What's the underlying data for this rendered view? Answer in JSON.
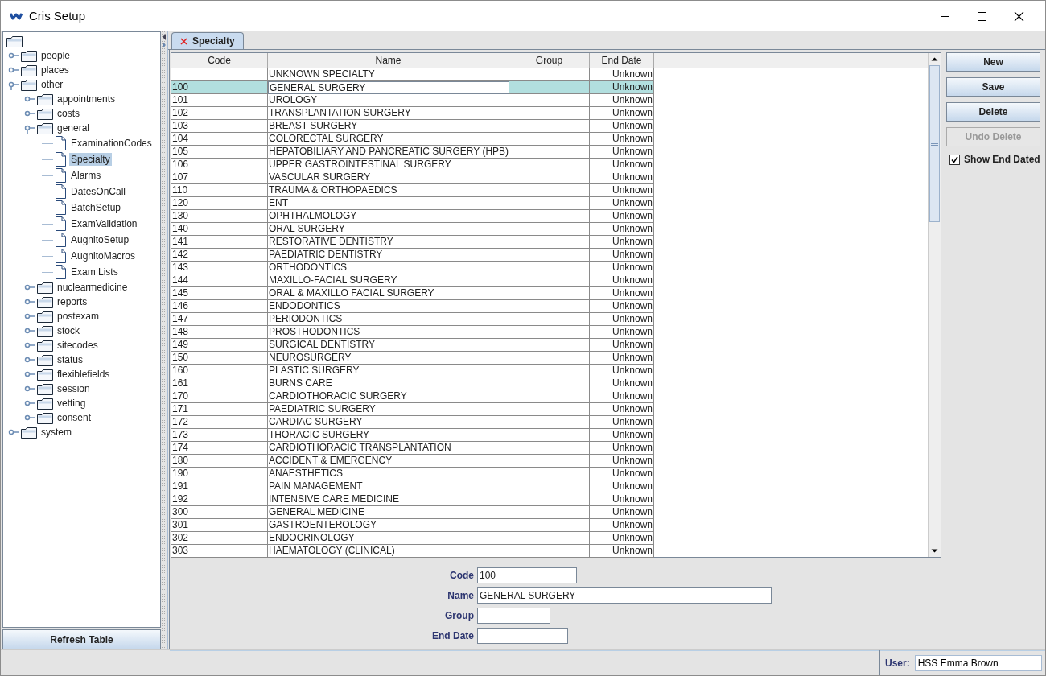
{
  "window": {
    "title": "Cris Setup"
  },
  "tree": {
    "kind": "root",
    "children": [
      {
        "kind": "folder",
        "label": "people",
        "expanded": false,
        "selected": false
      },
      {
        "kind": "folder",
        "label": "places",
        "expanded": false,
        "selected": false
      },
      {
        "kind": "folder",
        "label": "other",
        "expanded": true,
        "selected": false,
        "children": [
          {
            "kind": "folder",
            "label": "appointments",
            "expanded": false,
            "selected": false
          },
          {
            "kind": "folder",
            "label": "costs",
            "expanded": false,
            "selected": false
          },
          {
            "kind": "folder",
            "label": "general",
            "expanded": true,
            "selected": false,
            "children": [
              {
                "kind": "leaf",
                "label": "ExaminationCodes",
                "selected": false
              },
              {
                "kind": "leaf",
                "label": "Specialty",
                "selected": true
              },
              {
                "kind": "leaf",
                "label": "Alarms",
                "selected": false
              },
              {
                "kind": "leaf",
                "label": "DatesOnCall",
                "selected": false
              },
              {
                "kind": "leaf",
                "label": "BatchSetup",
                "selected": false
              },
              {
                "kind": "leaf",
                "label": "ExamValidation",
                "selected": false
              },
              {
                "kind": "leaf",
                "label": "AugnitoSetup",
                "selected": false
              },
              {
                "kind": "leaf",
                "label": "AugnitoMacros",
                "selected": false
              },
              {
                "kind": "leaf",
                "label": "Exam Lists",
                "selected": false
              }
            ]
          },
          {
            "kind": "folder",
            "label": "nuclearmedicine",
            "expanded": false,
            "selected": false
          },
          {
            "kind": "folder",
            "label": "reports",
            "expanded": false,
            "selected": false
          },
          {
            "kind": "folder",
            "label": "postexam",
            "expanded": false,
            "selected": false
          },
          {
            "kind": "folder",
            "label": "stock",
            "expanded": false,
            "selected": false
          },
          {
            "kind": "folder",
            "label": "sitecodes",
            "expanded": false,
            "selected": false
          },
          {
            "kind": "folder",
            "label": "status",
            "expanded": false,
            "selected": false
          },
          {
            "kind": "folder",
            "label": "flexiblefields",
            "expanded": false,
            "selected": false
          },
          {
            "kind": "folder",
            "label": "session",
            "expanded": false,
            "selected": false
          },
          {
            "kind": "folder",
            "label": "vetting",
            "expanded": false,
            "selected": false
          },
          {
            "kind": "folder",
            "label": "consent",
            "expanded": false,
            "selected": false
          }
        ]
      },
      {
        "kind": "folder",
        "label": "system",
        "expanded": false,
        "selected": false
      }
    ]
  },
  "refresh_button": "Refresh Table",
  "tabs": [
    {
      "label": "Specialty",
      "selected": true
    }
  ],
  "table": {
    "columns": [
      "Code",
      "Name",
      "Group",
      "End Date"
    ],
    "rows": [
      {
        "name": "UNKNOWN SPECIALTY",
        "end_date": "Unknown",
        "selected": false
      },
      {
        "code": "100",
        "name": "GENERAL SURGERY",
        "end_date": "Unknown",
        "selected": true
      },
      {
        "code": "101",
        "name": "UROLOGY",
        "end_date": "Unknown",
        "selected": false
      },
      {
        "code": "102",
        "name": "TRANSPLANTATION SURGERY",
        "end_date": "Unknown",
        "selected": false
      },
      {
        "code": "103",
        "name": "BREAST SURGERY",
        "end_date": "Unknown",
        "selected": false
      },
      {
        "code": "104",
        "name": "COLORECTAL SURGERY",
        "end_date": "Unknown",
        "selected": false
      },
      {
        "code": "105",
        "name": "HEPATOBILIARY AND PANCREATIC SURGERY (HPB)",
        "end_date": "Unknown",
        "selected": false
      },
      {
        "code": "106",
        "name": "UPPER GASTROINTESTINAL SURGERY",
        "end_date": "Unknown",
        "selected": false
      },
      {
        "code": "107",
        "name": "VASCULAR SURGERY",
        "end_date": "Unknown",
        "selected": false
      },
      {
        "code": "110",
        "name": "TRAUMA & ORTHOPAEDICS",
        "end_date": "Unknown",
        "selected": false
      },
      {
        "code": "120",
        "name": "ENT",
        "end_date": "Unknown",
        "selected": false
      },
      {
        "code": "130",
        "name": "OPHTHALMOLOGY",
        "end_date": "Unknown",
        "selected": false
      },
      {
        "code": "140",
        "name": "ORAL SURGERY",
        "end_date": "Unknown",
        "selected": false
      },
      {
        "code": "141",
        "name": "RESTORATIVE DENTISTRY",
        "end_date": "Unknown",
        "selected": false
      },
      {
        "code": "142",
        "name": "PAEDIATRIC DENTISTRY",
        "end_date": "Unknown",
        "selected": false
      },
      {
        "code": "143",
        "name": "ORTHODONTICS",
        "end_date": "Unknown",
        "selected": false
      },
      {
        "code": "144",
        "name": "MAXILLO-FACIAL SURGERY",
        "end_date": "Unknown",
        "selected": false
      },
      {
        "code": "145",
        "name": "ORAL & MAXILLO FACIAL SURGERY",
        "end_date": "Unknown",
        "selected": false
      },
      {
        "code": "146",
        "name": "ENDODONTICS",
        "end_date": "Unknown",
        "selected": false
      },
      {
        "code": "147",
        "name": "PERIODONTICS",
        "end_date": "Unknown",
        "selected": false
      },
      {
        "code": "148",
        "name": "PROSTHODONTICS",
        "end_date": "Unknown",
        "selected": false
      },
      {
        "code": "149",
        "name": "SURGICAL DENTISTRY",
        "end_date": "Unknown",
        "selected": false
      },
      {
        "code": "150",
        "name": "NEUROSURGERY",
        "end_date": "Unknown",
        "selected": false
      },
      {
        "code": "160",
        "name": "PLASTIC SURGERY",
        "end_date": "Unknown",
        "selected": false
      },
      {
        "code": "161",
        "name": "BURNS CARE",
        "end_date": "Unknown",
        "selected": false
      },
      {
        "code": "170",
        "name": "CARDIOTHORACIC SURGERY",
        "end_date": "Unknown",
        "selected": false
      },
      {
        "code": "171",
        "name": "PAEDIATRIC SURGERY",
        "end_date": "Unknown",
        "selected": false
      },
      {
        "code": "172",
        "name": "CARDIAC SURGERY",
        "end_date": "Unknown",
        "selected": false
      },
      {
        "code": "173",
        "name": "THORACIC SURGERY",
        "end_date": "Unknown",
        "selected": false
      },
      {
        "code": "174",
        "name": "CARDIOTHORACIC TRANSPLANTATION",
        "end_date": "Unknown",
        "selected": false
      },
      {
        "code": "180",
        "name": "ACCIDENT & EMERGENCY",
        "end_date": "Unknown",
        "selected": false
      },
      {
        "code": "190",
        "name": "ANAESTHETICS",
        "end_date": "Unknown",
        "selected": false
      },
      {
        "code": "191",
        "name": "PAIN MANAGEMENT",
        "end_date": "Unknown",
        "selected": false
      },
      {
        "code": "192",
        "name": "INTENSIVE CARE MEDICINE",
        "end_date": "Unknown",
        "selected": false
      },
      {
        "code": "300",
        "name": "GENERAL MEDICINE",
        "end_date": "Unknown",
        "selected": false
      },
      {
        "code": "301",
        "name": "GASTROENTEROLOGY",
        "end_date": "Unknown",
        "selected": false
      },
      {
        "code": "302",
        "name": "ENDOCRINOLOGY",
        "end_date": "Unknown",
        "selected": false
      },
      {
        "code": "303",
        "name": "HAEMATOLOGY (CLINICAL)",
        "end_date": "Unknown",
        "selected": false
      }
    ]
  },
  "buttons": [
    {
      "label": "New",
      "disabled": false
    },
    {
      "label": "Save",
      "disabled": false
    },
    {
      "label": "Delete",
      "disabled": false
    },
    {
      "label": "Undo Delete",
      "disabled": true
    }
  ],
  "show_end_dated": {
    "label": "Show End Dated",
    "checked": true
  },
  "form": {
    "fields": [
      {
        "label": "Code",
        "value": "100"
      },
      {
        "label": "Name",
        "value": "GENERAL SURGERY"
      },
      {
        "label": "Group"
      },
      {
        "label": "End Date"
      }
    ]
  },
  "status_bar": {
    "user_label": "User:",
    "user": "HSS Emma Brown"
  }
}
